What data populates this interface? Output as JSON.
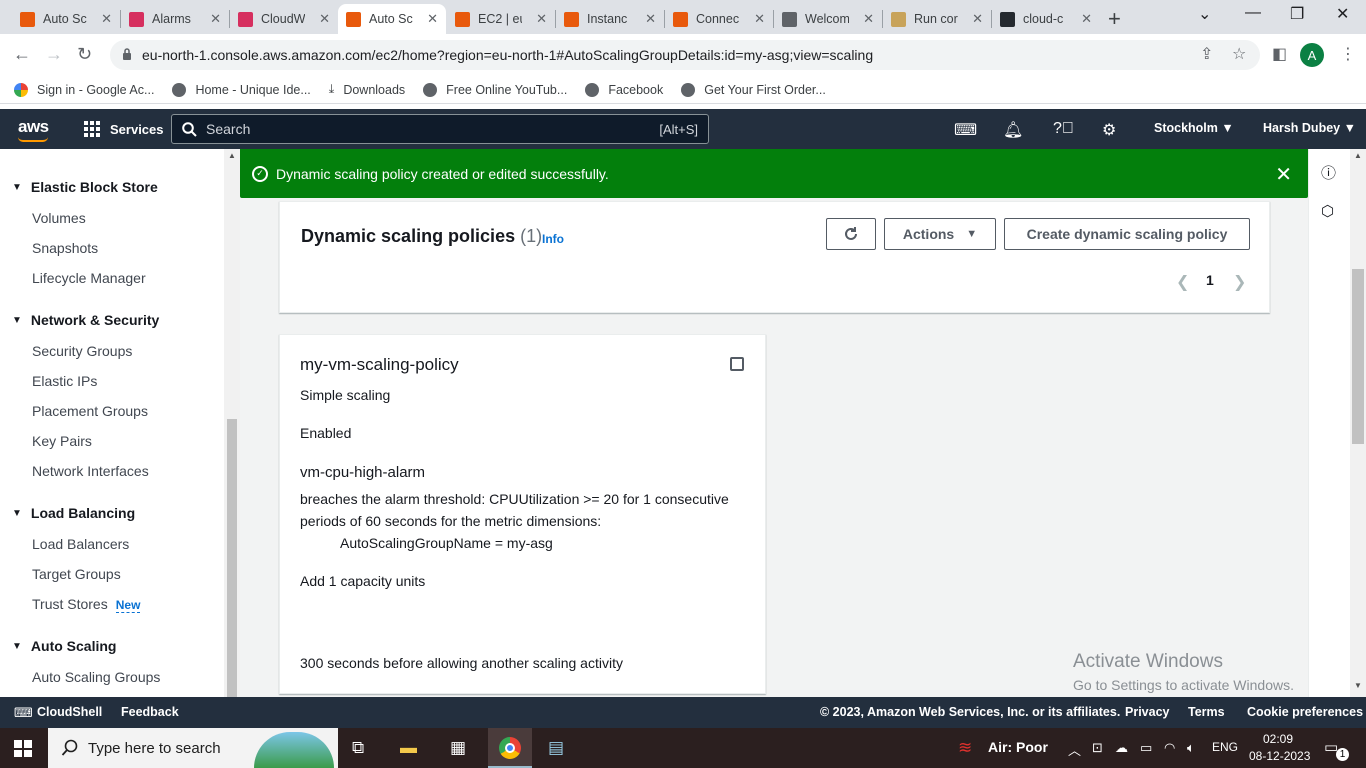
{
  "browser": {
    "tabs": [
      {
        "title": "Auto Sc",
        "icon": "aws-icon",
        "active": false
      },
      {
        "title": "Alarms",
        "icon": "cloudwatch-icon",
        "active": false
      },
      {
        "title": "CloudW",
        "icon": "cloudwatch-icon",
        "active": false
      },
      {
        "title": "Auto Sc",
        "icon": "aws-icon",
        "active": true
      },
      {
        "title": "EC2 | eu",
        "icon": "aws-icon",
        "active": false
      },
      {
        "title": "Instanc",
        "icon": "aws-icon",
        "active": false
      },
      {
        "title": "Connec",
        "icon": "aws-icon",
        "active": false
      },
      {
        "title": "Welcom",
        "icon": "globe-icon",
        "active": false
      },
      {
        "title": "Run cor",
        "icon": "box-icon",
        "active": false
      },
      {
        "title": "cloud-c",
        "icon": "github-icon",
        "active": false
      }
    ],
    "url": "eu-north-1.console.aws.amazon.com/ec2/home?region=eu-north-1#AutoScalingGroupDetails:id=my-asg;view=scaling",
    "avatar_letter": "A",
    "bookmarks": [
      {
        "label": "Sign in - Google Ac...",
        "icon": "google-icon"
      },
      {
        "label": "Home - Unique Ide...",
        "icon": "globe-icon"
      },
      {
        "label": "Downloads",
        "icon": "download-icon"
      },
      {
        "label": "Free Online YouTub...",
        "icon": "globe-icon"
      },
      {
        "label": "Facebook",
        "icon": "globe-icon"
      },
      {
        "label": "Get Your First Order...",
        "icon": "globe-icon"
      }
    ]
  },
  "aws_nav": {
    "logo": "aws",
    "services": "Services",
    "search_placeholder": "Search",
    "search_hint": "[Alt+S]",
    "region": "Stockholm",
    "user": "Harsh Dubey"
  },
  "sidebar": {
    "sections": [
      {
        "title": "Elastic Block Store",
        "items": [
          "Volumes",
          "Snapshots",
          "Lifecycle Manager"
        ]
      },
      {
        "title": "Network & Security",
        "items": [
          "Security Groups",
          "Elastic IPs",
          "Placement Groups",
          "Key Pairs",
          "Network Interfaces"
        ]
      },
      {
        "title": "Load Balancing",
        "items": [
          "Load Balancers",
          "Target Groups",
          "Trust Stores"
        ]
      },
      {
        "title": "Auto Scaling",
        "items": [
          "Auto Scaling Groups"
        ]
      }
    ],
    "new_badge": "New"
  },
  "flash": {
    "message": "Dynamic scaling policy created or edited successfully.",
    "color": "#037f0c"
  },
  "policies": {
    "title": "Dynamic scaling policies",
    "count": "(1)",
    "info": "Info",
    "actions_label": "Actions",
    "create_label": "Create dynamic scaling policy",
    "page": "1"
  },
  "policy_card": {
    "name": "my-vm-scaling-policy",
    "type": "Simple scaling",
    "status": "Enabled",
    "alarm_name": "vm-cpu-high-alarm",
    "alarm_line1": "breaches the alarm threshold: CPUUtilization >= 20 for 1 consecutive",
    "alarm_line2": "periods of 60 seconds for the metric dimensions:",
    "dimension": "AutoScalingGroupName = my-asg",
    "action": "Add 1 capacity units",
    "cooldown": "300 seconds before allowing another scaling activity"
  },
  "watermark": {
    "line1": "Activate Windows",
    "line2": "Go to Settings to activate Windows."
  },
  "footer": {
    "cloudshell": "CloudShell",
    "feedback": "Feedback",
    "copyright": "© 2023, Amazon Web Services, Inc. or its affiliates.",
    "privacy": "Privacy",
    "terms": "Terms",
    "cookies": "Cookie preferences"
  },
  "taskbar": {
    "search_placeholder": "Type here to search",
    "air_quality": "Air: Poor",
    "language": "ENG",
    "time": "02:09",
    "date": "08-12-2023",
    "notifications": "1"
  }
}
